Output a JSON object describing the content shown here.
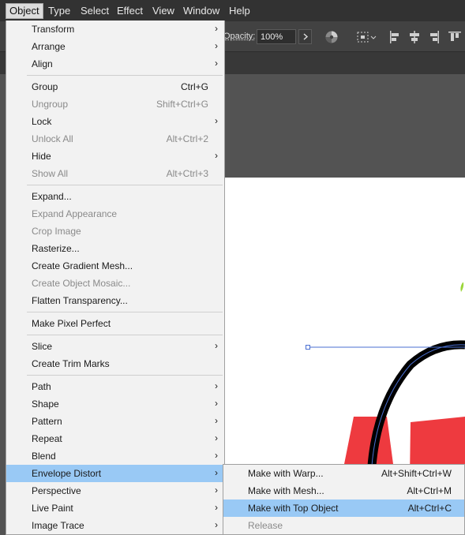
{
  "menubar": {
    "items": [
      {
        "label": "Object",
        "active": true
      },
      {
        "label": "Type"
      },
      {
        "label": "Select"
      },
      {
        "label": "Effect"
      },
      {
        "label": "View"
      },
      {
        "label": "Window"
      },
      {
        "label": "Help"
      }
    ]
  },
  "control_bar": {
    "opacity_label": "Opacity:",
    "opacity_value": "100%"
  },
  "object_menu": {
    "items": [
      {
        "label": "Transform",
        "submenu": true
      },
      {
        "label": "Arrange",
        "submenu": true
      },
      {
        "label": "Align",
        "submenu": true
      },
      {
        "label": "Group",
        "shortcut": "Ctrl+G"
      },
      {
        "label": "Ungroup",
        "shortcut": "Shift+Ctrl+G",
        "disabled": true
      },
      {
        "label": "Lock",
        "submenu": true
      },
      {
        "label": "Unlock All",
        "shortcut": "Alt+Ctrl+2",
        "disabled": true
      },
      {
        "label": "Hide",
        "submenu": true
      },
      {
        "label": "Show All",
        "shortcut": "Alt+Ctrl+3",
        "disabled": true
      },
      {
        "label": "Expand..."
      },
      {
        "label": "Expand Appearance",
        "disabled": true
      },
      {
        "label": "Crop Image",
        "disabled": true
      },
      {
        "label": "Rasterize..."
      },
      {
        "label": "Create Gradient Mesh..."
      },
      {
        "label": "Create Object Mosaic...",
        "disabled": true
      },
      {
        "label": "Flatten Transparency..."
      },
      {
        "label": "Make Pixel Perfect"
      },
      {
        "label": "Slice",
        "submenu": true
      },
      {
        "label": "Create Trim Marks"
      },
      {
        "label": "Path",
        "submenu": true
      },
      {
        "label": "Shape",
        "submenu": true
      },
      {
        "label": "Pattern",
        "submenu": true
      },
      {
        "label": "Repeat",
        "submenu": true
      },
      {
        "label": "Blend",
        "submenu": true
      },
      {
        "label": "Envelope Distort",
        "submenu": true,
        "highlighted": true
      },
      {
        "label": "Perspective",
        "submenu": true
      },
      {
        "label": "Live Paint",
        "submenu": true
      },
      {
        "label": "Image Trace",
        "submenu": true
      }
    ]
  },
  "envelope_submenu": {
    "items": [
      {
        "label": "Make with Warp...",
        "shortcut": "Alt+Shift+Ctrl+W"
      },
      {
        "label": "Make with Mesh...",
        "shortcut": "Alt+Ctrl+M"
      },
      {
        "label": "Make with Top Object",
        "shortcut": "Alt+Ctrl+C",
        "highlighted": true
      },
      {
        "label": "Release",
        "disabled": true
      }
    ]
  },
  "colors": {
    "highlight": "#99c9f5",
    "menubar_bg": "#323232",
    "artwork_red": "#ee3a3f",
    "artwork_green": "#9bd63a",
    "selection_blue": "#4a6fd1"
  }
}
